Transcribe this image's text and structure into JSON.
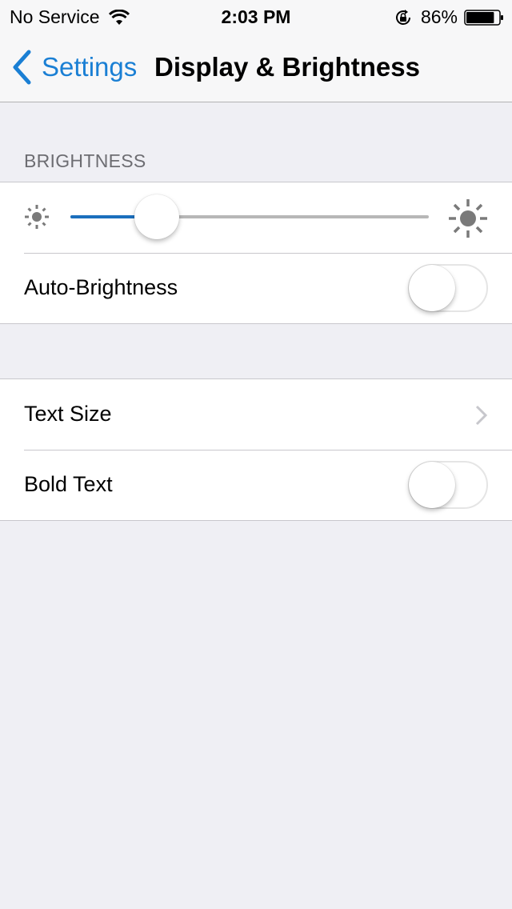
{
  "status_bar": {
    "carrier": "No Service",
    "time": "2:03 PM",
    "battery_percent": "86%",
    "battery_level": 0.86,
    "icons": [
      "wifi-icon",
      "rotation-lock-icon",
      "battery-icon"
    ]
  },
  "nav": {
    "back_label": "Settings",
    "title": "Display & Brightness"
  },
  "sections": {
    "brightness": {
      "header": "BRIGHTNESS",
      "slider_value": 0.24,
      "min_icon": "sun-small-icon",
      "max_icon": "sun-large-icon",
      "auto_brightness": {
        "label": "Auto-Brightness",
        "on": false
      }
    },
    "text": {
      "text_size": {
        "label": "Text Size"
      },
      "bold_text": {
        "label": "Bold Text",
        "on": false
      }
    }
  },
  "colors": {
    "accent": "#1a7fd4",
    "slider_fill": "#1b6fbd",
    "slider_track": "#b7b7b7",
    "background": "#efeff4",
    "section_header": "#6d6d72"
  }
}
